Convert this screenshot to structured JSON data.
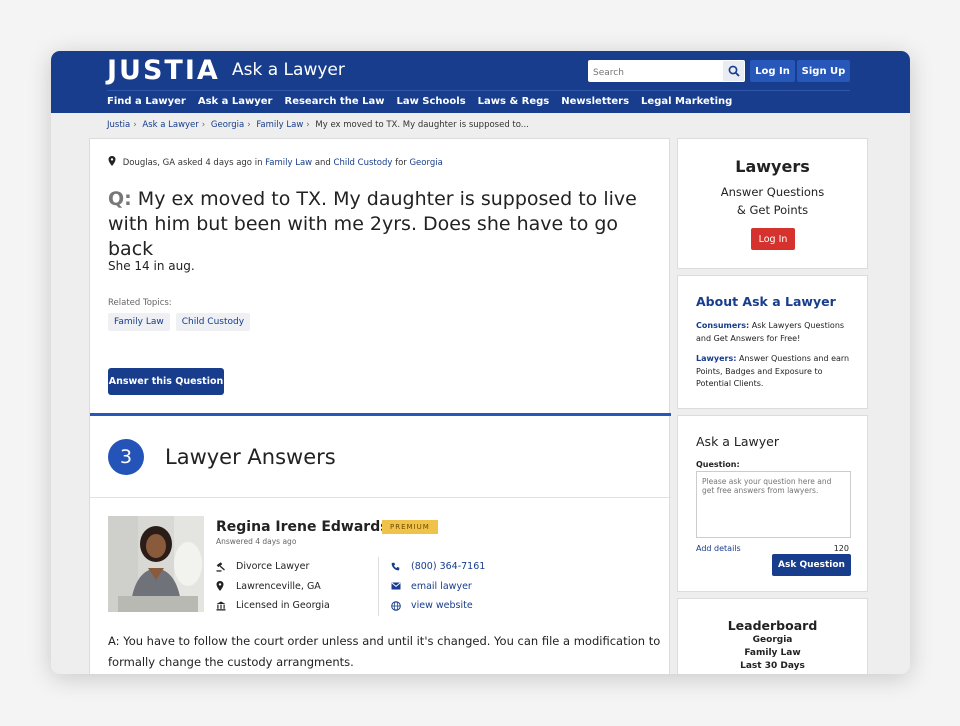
{
  "header": {
    "logo": "JUSTIA",
    "logo_sub": "Ask a Lawyer",
    "search_placeholder": "Search",
    "login_label": "Log In",
    "signup_label": "Sign Up",
    "nav": [
      "Find a Lawyer",
      "Ask a Lawyer",
      "Research the Law",
      "Law Schools",
      "Laws & Regs",
      "Newsletters",
      "Legal Marketing"
    ],
    "brand_color": "#173d8c"
  },
  "breadcrumb": {
    "items": [
      "Justia",
      "Ask a Lawyer",
      "Georgia",
      "Family Law"
    ],
    "current": "My ex moved to TX. My daughter is supposed to..."
  },
  "question": {
    "asked_prefix": "Douglas, GA asked 4 days ago in",
    "topic1": "Family Law",
    "and": "and",
    "topic2": "Child Custody",
    "for": "for",
    "state": "Georgia",
    "q_prefix": "Q:",
    "title": "My ex moved to TX. My daughter is supposed to live with him but been with me 2yrs. Does she have to go back",
    "body": "She 14 in aug.",
    "related_label": "Related Topics:",
    "tags": [
      "Family Law",
      "Child Custody"
    ],
    "answer_button": "Answer this Question"
  },
  "answers": {
    "count": "3",
    "title": "Lawyer Answers",
    "first": {
      "name": "Regina Irene Edwards",
      "badge": "PREMIUM",
      "answered": "Answered 4 days ago",
      "practice": "Divorce Lawyer",
      "location": "Lawrenceville, GA",
      "license": "Licensed in Georgia",
      "phone": "(800) 364-7161",
      "email": "email lawyer",
      "website": "view website",
      "text": "A: You have to follow the court order unless and until it's changed. You can file a modification to formally change the custody arrangments."
    }
  },
  "sidebar": {
    "lawyers": {
      "title": "Lawyers",
      "subtitle1": "Answer Questions",
      "subtitle2": "& Get Points",
      "button": "Log In"
    },
    "about": {
      "title": "About Ask a Lawyer",
      "consumers_label": "Consumers:",
      "consumers_text": "Ask Lawyers Questions and Get Answers for Free!",
      "lawyers_label": "Lawyers:",
      "lawyers_text": "Answer Questions and earn Points, Badges and Exposure to Potential Clients."
    },
    "ask": {
      "title": "Ask a Lawyer",
      "question_label": "Question:",
      "placeholder": "Please ask your question here and get free answers from lawyers.",
      "add_details": "Add details",
      "counter": "120",
      "button": "Ask Question"
    },
    "leaderboard": {
      "title": "Leaderboard",
      "line1": "Georgia",
      "line2": "Family Law",
      "line3": "Last 30 Days"
    }
  }
}
